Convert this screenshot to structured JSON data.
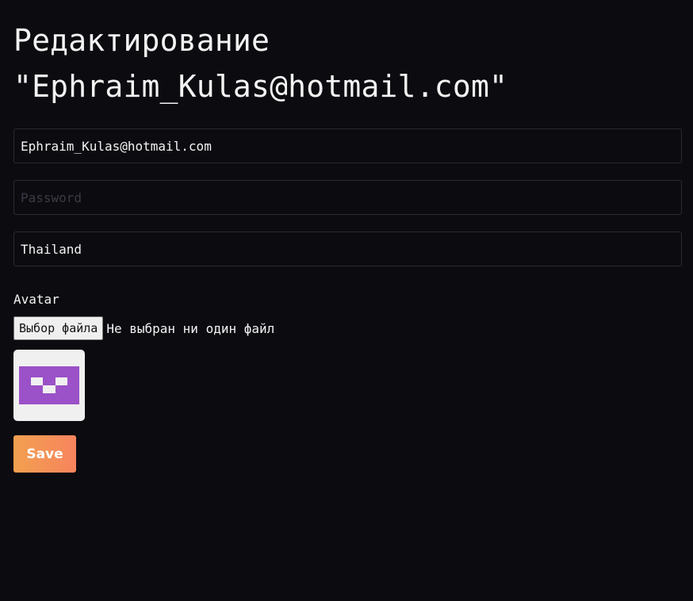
{
  "page": {
    "title_line1": "Редактирование",
    "title_line2": "\"Ephraim_Kulas@hotmail.com\""
  },
  "form": {
    "email": {
      "value": "Ephraim_Kulas@hotmail.com",
      "placeholder": ""
    },
    "password": {
      "value": "",
      "placeholder": "Password"
    },
    "country": {
      "value": "Thailand",
      "placeholder": ""
    },
    "avatar_label": "Avatar",
    "file_button_label": "Выбор файла",
    "file_status": "Не выбран ни один файл",
    "save_label": "Save"
  },
  "colors": {
    "background": "#0c0b10",
    "avatar_pattern": "#9b51c7",
    "save_gradient_start": "#f2a050",
    "save_gradient_end": "#f7845e"
  },
  "icons": {
    "avatar": "identicon-avatar"
  }
}
